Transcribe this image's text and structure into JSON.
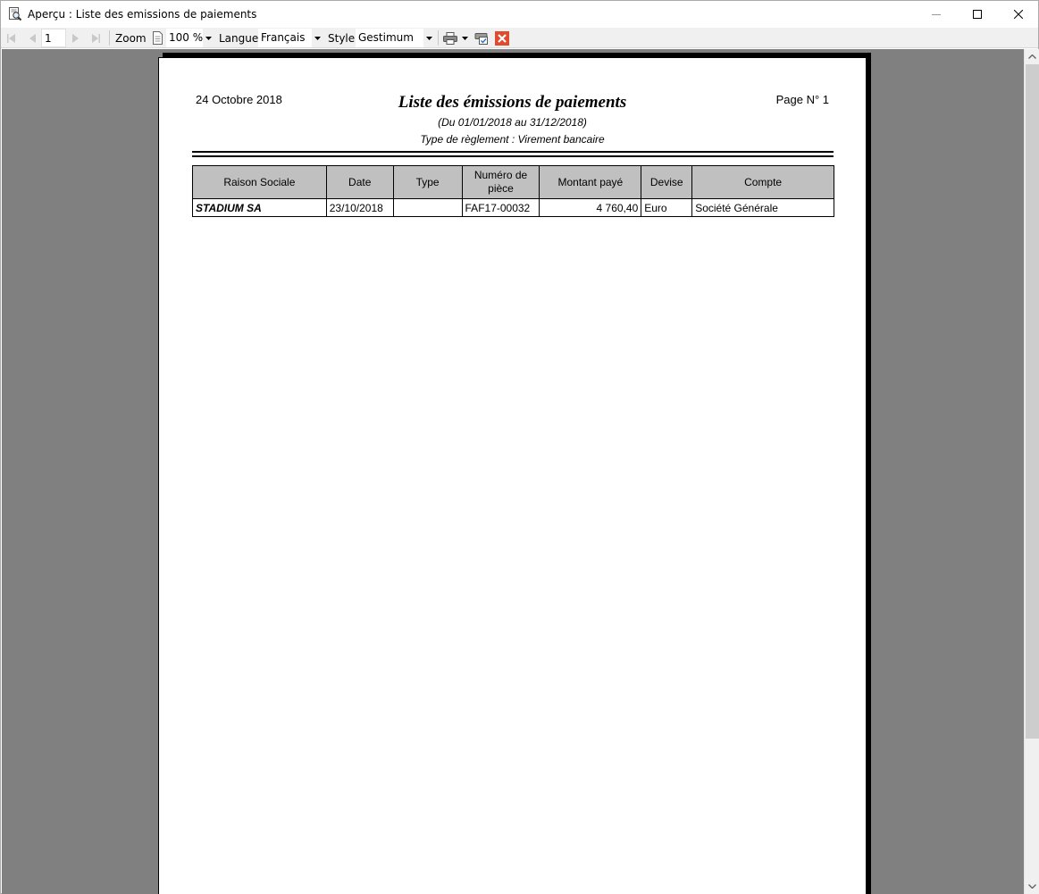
{
  "window": {
    "title": "Aperçu : Liste des emissions de paiements"
  },
  "toolbar": {
    "page_number": "1",
    "zoom_label": "Zoom",
    "zoom_value": "100 %",
    "language_label": "Langue",
    "language_value": "Français",
    "style_label": "Style",
    "style_value": "Gestimum",
    "colors": {
      "close_accent": "#e04a2f"
    }
  },
  "report": {
    "date": "24 Octobre 2018",
    "title": "Liste des émissions de paiements",
    "page": "Page N° 1",
    "period": "(Du 01/01/2018 au 31/12/2018)",
    "payment_type": "Type de règlement : Virement bancaire",
    "columns": [
      "Raison Sociale",
      "Date",
      "Type",
      "Numéro de pièce",
      "Montant payé",
      "Devise",
      "Compte"
    ],
    "rows": [
      [
        "STADIUM SA",
        "23/10/2018",
        "",
        "FAF17-00032",
        "4 760,40",
        "Euro",
        "Société Générale"
      ]
    ]
  }
}
